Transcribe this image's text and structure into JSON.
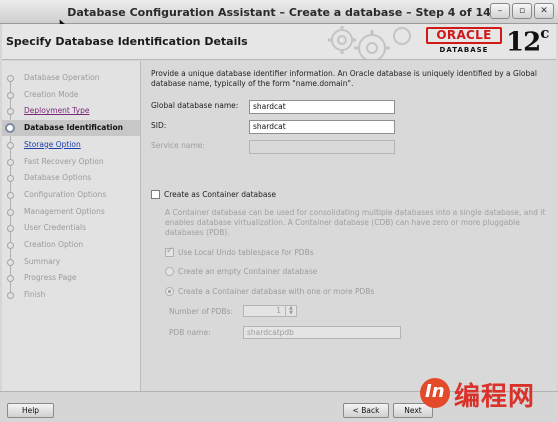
{
  "window": {
    "title": "Database Configuration Assistant – Create a database – Step 4 of 14",
    "buttons": [
      "–",
      "▫",
      "✕"
    ]
  },
  "header": {
    "page_title": "Specify Database Identification Details",
    "logo_word": "ORACLE",
    "logo_sub": "DATABASE",
    "version": "12",
    "version_sup": "c"
  },
  "sidebar": {
    "steps": [
      {
        "label": "Database Operation",
        "state": "disabled"
      },
      {
        "label": "Creation Mode",
        "state": "disabled"
      },
      {
        "label": "Deployment Type",
        "state": "done"
      },
      {
        "label": "Database Identification",
        "state": "current"
      },
      {
        "label": "Storage Option",
        "state": "next"
      },
      {
        "label": "Fast Recovery Option",
        "state": "disabled"
      },
      {
        "label": "Database Options",
        "state": "disabled"
      },
      {
        "label": "Configuration Options",
        "state": "disabled"
      },
      {
        "label": "Management Options",
        "state": "disabled"
      },
      {
        "label": "User Credentials",
        "state": "disabled"
      },
      {
        "label": "Creation Option",
        "state": "disabled"
      },
      {
        "label": "Summary",
        "state": "disabled"
      },
      {
        "label": "Progress Page",
        "state": "disabled"
      },
      {
        "label": "Finish",
        "state": "disabled"
      }
    ]
  },
  "main": {
    "intro": "Provide a unique database identifier information. An Oracle database is uniquely identified by a Global database name, typically of the form \"name.domain\".",
    "global_db_label": "Global database name:",
    "global_db_value": "shardcat",
    "sid_label": "SID:",
    "sid_value": "shardcat",
    "service_label": "Service name:",
    "service_value": "",
    "container_label": "Create as Container database",
    "container_desc": "A Container database can be used for consolidating multiple databases into a single database, and it enables database virtualization. A Container database (CDB) can have zero or more pluggable databases (PDB).",
    "undo_label": "Use Local Undo tablespace for PDBs",
    "empty_label": "Create an empty Container database",
    "with_pdbs_label": "Create a Container database with one or more PDBs",
    "num_pdbs_label": "Number of PDBs:",
    "num_pdbs_value": "1",
    "pdb_name_label": "PDB name:",
    "pdb_name_value": "shardcatpdb"
  },
  "footer": {
    "help": "Help",
    "back": "< Back",
    "next": "Next"
  },
  "watermark": {
    "text": "编程网",
    "logo": "In"
  }
}
